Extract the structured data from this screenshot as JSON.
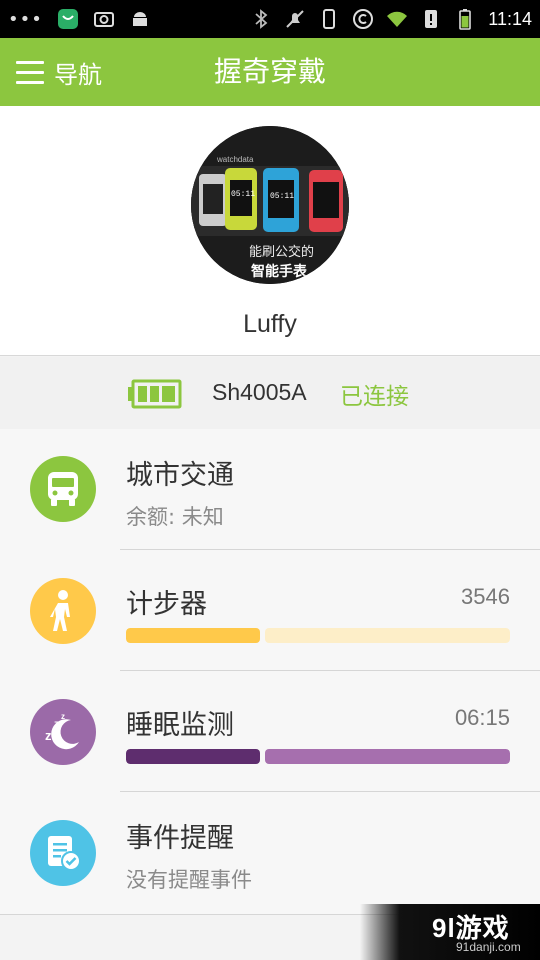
{
  "status_bar": {
    "dots": "•••",
    "time": "11:14"
  },
  "action_bar": {
    "nav_label": "导航",
    "title": "握奇穿戴"
  },
  "profile": {
    "username": "Luffy",
    "avatar_caption_line1": "能刷公交的",
    "avatar_caption_line2": "智能手表",
    "avatar_brand": "watchdata",
    "avatar_watch_time": "05:11"
  },
  "device": {
    "name": "Sh4005A",
    "status": "已连接",
    "battery_level": 1.0
  },
  "items": [
    {
      "title": "城市交通",
      "subtitle": "余额: 未知",
      "icon": "bus-icon",
      "color": "#8cc63f"
    },
    {
      "title": "计步器",
      "value": "3546",
      "icon": "walking-person-icon",
      "color": "#ffc94a",
      "progress": 0.35,
      "bar_fill_color": "#ffc94a",
      "bar_rest_color": "#fdeec8"
    },
    {
      "title": "睡眠监测",
      "value": "06:15",
      "icon": "sleep-moon-icon",
      "color": "#9b6aa8",
      "progress": 0.35,
      "bar_fill_color": "#5e2d6e",
      "bar_rest_color": "#a66fae"
    },
    {
      "title": "事件提醒",
      "subtitle": "没有提醒事件",
      "icon": "reminder-checklist-icon",
      "color": "#4fc3e6"
    }
  ],
  "watermark": {
    "logo": "9l游戏",
    "url": "91danji.com"
  },
  "colors": {
    "brand_green": "#8cc63f"
  }
}
